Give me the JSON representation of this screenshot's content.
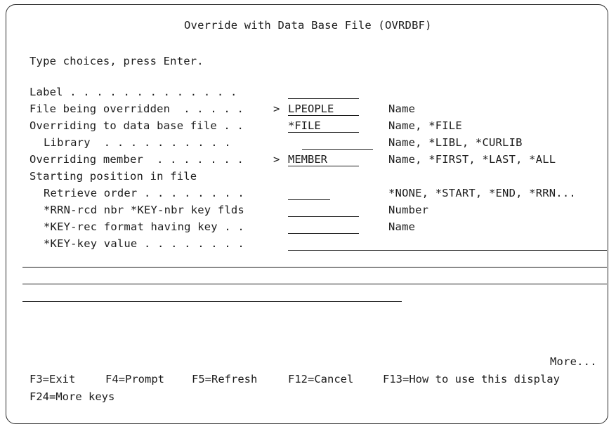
{
  "screen": {
    "title": "Override with Data Base File (OVRDBF)",
    "instruction": "Type choices, press Enter."
  },
  "rows": [
    {
      "label": "Label . . . . . . . . . . . . .",
      "marker": "",
      "value": "",
      "hint": ""
    },
    {
      "label": "File being overridden  . . . . .",
      "marker": ">",
      "value": "LPEOPLE",
      "hint": "Name"
    },
    {
      "label": "Overriding to data base file . .",
      "marker": "",
      "value": "*FILE",
      "hint": "Name, *FILE"
    },
    {
      "label": "Library  . . . . . . . . . .",
      "marker": "",
      "value": "",
      "hint": "Name, *LIBL, *CURLIB"
    },
    {
      "label": "Overriding member  . . . . . . .",
      "marker": ">",
      "value": "MEMBER",
      "hint": "Name, *FIRST, *LAST, *ALL"
    },
    {
      "label": "Starting position in file",
      "marker": "",
      "value": "",
      "hint": ""
    },
    {
      "label": "Retrieve order . . . . . . . .",
      "marker": "",
      "value": "",
      "hint": "*NONE, *START, *END, *RRN..."
    },
    {
      "label": "*RRN-rcd nbr *KEY-nbr key flds",
      "marker": "",
      "value": "",
      "hint": "Number"
    },
    {
      "label": "*KEY-rec format having key . .",
      "marker": "",
      "value": "",
      "hint": "Name"
    },
    {
      "label": "*KEY-key value . . . . . . . .",
      "marker": "",
      "value": "",
      "hint": ""
    }
  ],
  "more": "More...",
  "function_keys": {
    "f3": "F3=Exit",
    "f4": "F4=Prompt",
    "f5": "F5=Refresh",
    "f12": "F12=Cancel",
    "f13": "F13=How to use this display",
    "f24": "F24=More keys"
  }
}
